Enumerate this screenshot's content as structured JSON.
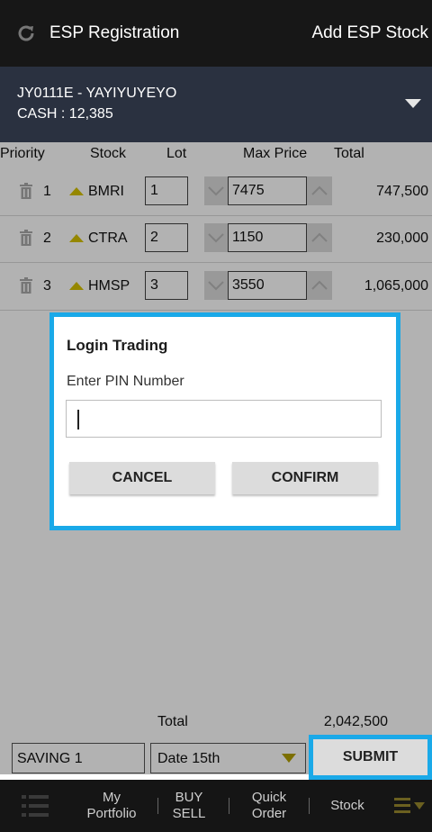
{
  "header": {
    "title": "ESP Registration",
    "action": "Add ESP Stock"
  },
  "account": {
    "code_line": "JY0111E - YAYIYUYEYO",
    "cash_line": "CASH : 12,385"
  },
  "table": {
    "columns": [
      "Priority",
      "Stock",
      "Lot",
      "Max Price",
      "Total"
    ],
    "rows": [
      {
        "priority": "1",
        "stock": "BMRI",
        "lot": "1",
        "max_price": "7475",
        "total": "747,500"
      },
      {
        "priority": "2",
        "stock": "CTRA",
        "lot": "2",
        "max_price": "1150",
        "total": "230,000"
      },
      {
        "priority": "3",
        "stock": "HMSP",
        "lot": "3",
        "max_price": "3550",
        "total": "1,065,000"
      }
    ]
  },
  "dialog": {
    "title": "Login Trading",
    "label": "Enter PIN Number",
    "pin_value": "",
    "cancel": "CANCEL",
    "confirm": "CONFIRM"
  },
  "footer": {
    "total_label": "Total",
    "total_value": "2,042,500",
    "saving_value": "SAVING 1",
    "date_value": "Date 15th",
    "submit": "SUBMIT"
  },
  "nav": {
    "portfolio": [
      "My",
      "Portfolio"
    ],
    "buysell": [
      "BUY",
      "SELL"
    ],
    "quick": [
      "Quick",
      "Order"
    ],
    "stock": "Stock"
  },
  "colors": {
    "accent": "#1aa9e8",
    "arrow": "#d6c200",
    "header_bg": "#171717",
    "account_bg": "#2a3140"
  },
  "icons": [
    "refresh-icon",
    "dropdown-arrow-icon",
    "trash-icon",
    "arrow-up-icon",
    "chevron-down-icon",
    "chevron-up-icon",
    "menu-list-icon",
    "more-menu-icon"
  ]
}
